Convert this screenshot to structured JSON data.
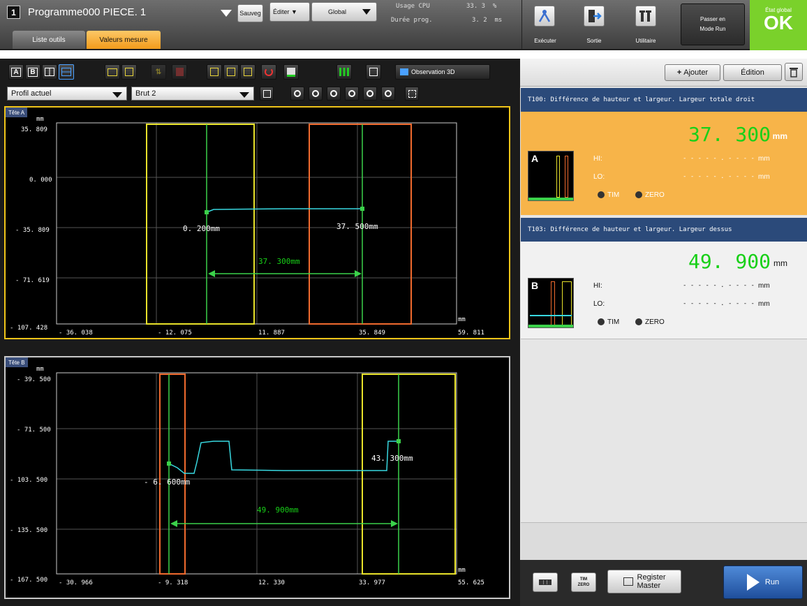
{
  "header": {
    "prog_index": "1",
    "program_name": "Programme000  PIECE. 1",
    "save_label": "Sauveg",
    "edit_label": "Éditer ▼",
    "scope_label": "Global",
    "cpu_label": "Usage CPU",
    "cpu_value": "33. 3  %",
    "time_label": "Durée prog.",
    "time_value": "3. 2  ms",
    "run_btn": "Exécuter",
    "exit_btn": "Sortie",
    "util_btn": "Utilitaire",
    "mode_line1": "Passer en",
    "mode_line2": "Mode Run",
    "global_state_label": "État global",
    "global_state_value": "OK"
  },
  "tabs": {
    "tools": "Liste outils",
    "values": "Valeurs mesure"
  },
  "toolbar": {
    "letter_a": "A",
    "letter_b": "B",
    "obs3d": "Observation 3D",
    "profile_select": "Profil actuel",
    "raw_select": "Brut 2"
  },
  "headA": {
    "title": "Tête A",
    "unit_y": "mm",
    "unit_x": "mm",
    "y_ticks": [
      "35. 809",
      "0. 000",
      "- 35. 809",
      "- 71. 619",
      "- 107. 428"
    ],
    "x_ticks": [
      "- 36. 038",
      "- 12. 075",
      "11. 887",
      "35. 849",
      "59. 811"
    ],
    "p1": "0. 200mm",
    "p2": "37. 500mm",
    "dist": "37. 300mm"
  },
  "headB": {
    "title": "Tête B",
    "unit_y": "mm",
    "unit_x": "mm",
    "y_ticks": [
      "- 39. 500",
      "- 71. 500",
      "- 103. 500",
      "- 135. 500",
      "- 167. 500"
    ],
    "x_ticks": [
      "- 30. 966",
      "- 9. 318",
      "12. 330",
      "33. 977",
      "55. 625"
    ],
    "p1": "- 6. 600mm",
    "p2": "43. 300mm",
    "dist": "49. 900mm"
  },
  "right": {
    "add_label": "Ajouter",
    "edit_label": "Édition",
    "t1_title": "T100: Différence de hauteur et largeur. Largeur totale droit",
    "t1_value": "37. 300",
    "t1_unit": "mm",
    "t1_thumb": "A",
    "t2_title": "T103: Différence de hauteur et largeur. Largeur dessus",
    "t2_value": "49. 900",
    "t2_unit": "mm",
    "t2_thumb": "B",
    "hi_label": "HI:",
    "lo_label": "LO:",
    "blank_value": "- - - - - . - - - -",
    "unit": "mm",
    "tim": "TIM",
    "zero": "ZERO"
  },
  "bottom": {
    "tim_line1": "TIM",
    "tim_line2": "ZERO",
    "register_line1": "Register",
    "register_line2": "Master",
    "run_label": "Run"
  },
  "colors": {
    "value_green": "#18d018",
    "selected_card": "#f7b449",
    "header_blue": "#2b4a7a",
    "ok_green": "#7ad12b",
    "frame_yellow": "#e8e22a",
    "frame_orange": "#f06a2e",
    "profile_cyan": "#38d8e0",
    "measure_green": "#3bd14a"
  }
}
